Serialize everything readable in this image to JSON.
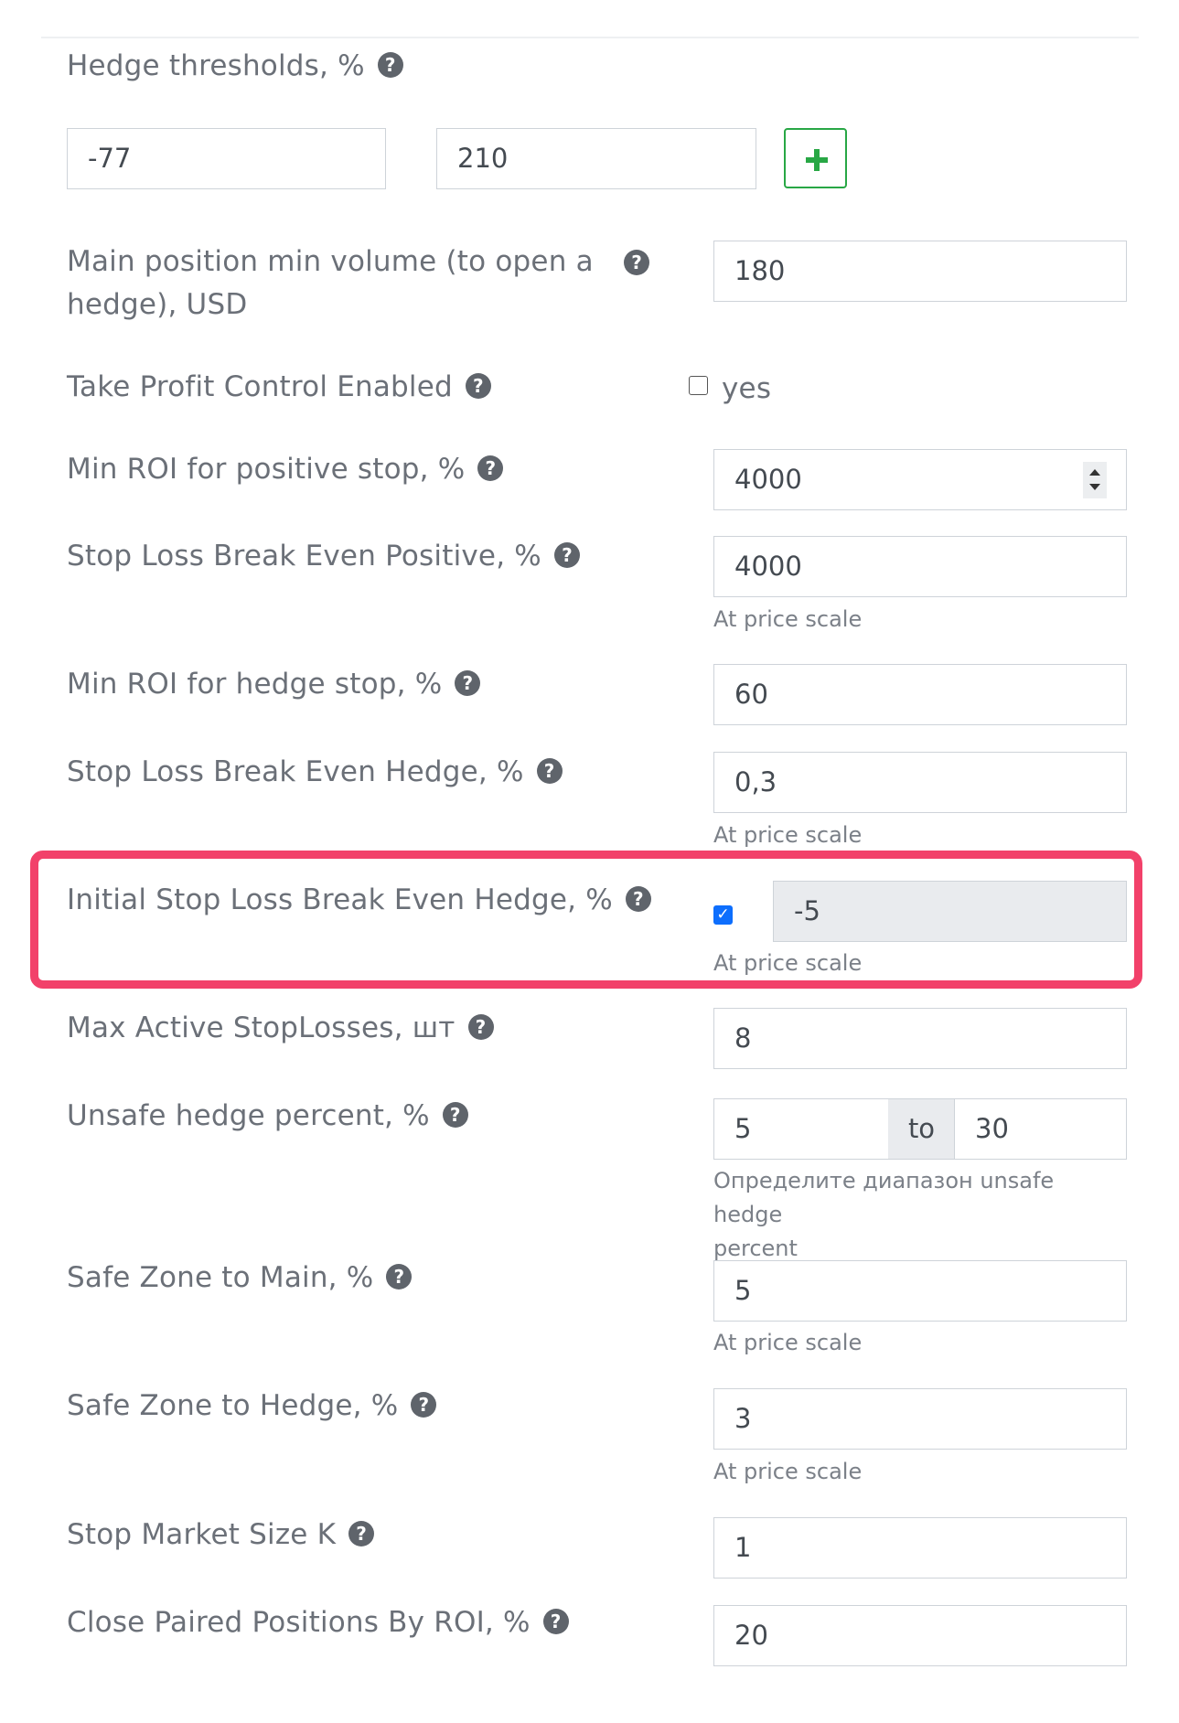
{
  "hedge_thresholds": {
    "label": "Hedge thresholds, %",
    "value1": "-77",
    "value2": "210",
    "add_icon": "plus-icon"
  },
  "main_position_min_volume": {
    "label_line1": "Main position min volume (to open a",
    "label_line2": "hedge), USD",
    "value": "180"
  },
  "take_profit_control": {
    "label": "Take Profit Control Enabled",
    "checkbox_label": "yes",
    "checked": false
  },
  "min_roi_positive_stop": {
    "label": "Min ROI for positive stop, %",
    "value": "4000"
  },
  "stop_loss_be_positive": {
    "label": "Stop Loss Break Even Positive, %",
    "value": "4000",
    "help": "At price scale"
  },
  "min_roi_hedge_stop": {
    "label": "Min ROI for hedge stop, %",
    "value": "60"
  },
  "stop_loss_be_hedge": {
    "label": "Stop Loss Break Even Hedge, %",
    "value": "0,3",
    "help": "At price scale"
  },
  "initial_stop_loss_be_hedge": {
    "label": "Initial Stop Loss Break Even Hedge, %",
    "checked": true,
    "value": "-5",
    "help": "At price scale",
    "highlight_color": "#f2416a"
  },
  "max_active_stoplosses": {
    "label": "Max Active StopLosses, шт",
    "value": "8"
  },
  "unsafe_hedge_percent": {
    "label": "Unsafe hedge percent, %",
    "from": "5",
    "to_label": "to",
    "to": "30",
    "help_line1": "Определите диапазон unsafe hedge",
    "help_line2": "percent"
  },
  "safe_zone_main": {
    "label": "Safe Zone to Main, %",
    "value": "5",
    "help": "At price scale"
  },
  "safe_zone_hedge": {
    "label": "Safe Zone to Hedge, %",
    "value": "3",
    "help": "At price scale"
  },
  "stop_market_size_k": {
    "label": "Stop Market Size K",
    "value": "1"
  },
  "close_paired_positions": {
    "label": "Close Paired Positions By ROI, %",
    "value": "20"
  },
  "help_icon": {
    "glyph": "?",
    "name": "question-circle-icon"
  },
  "colors": {
    "accent_green": "#28a745",
    "checkbox_blue": "#0d6efd",
    "text_gray": "#6b7078"
  }
}
